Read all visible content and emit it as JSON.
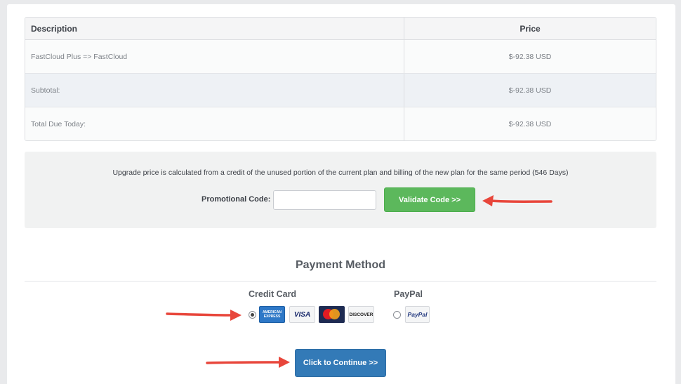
{
  "summary_table": {
    "columns": [
      "Description",
      "Price"
    ],
    "rows": [
      {
        "description": "FastCloud Plus => FastCloud",
        "price": "$-92.38 USD"
      },
      {
        "description": "Subtotal:",
        "price": "$-92.38 USD"
      },
      {
        "description": "Total Due Today:",
        "price": "$-92.38 USD"
      }
    ]
  },
  "promo": {
    "note": "Upgrade price is calculated from a credit of the unused portion of the current plan and billing of the new plan for the same period (546 Days)",
    "label": "Promotional Code:",
    "value": "",
    "placeholder": "",
    "validate_label": "Validate Code >>"
  },
  "payment": {
    "title": "Payment Method",
    "credit_card_label": "Credit Card",
    "paypal_label": "PayPal",
    "selected": "credit_card",
    "cards": [
      "AMERICAN EXPRESS",
      "VISA",
      "mastercard",
      "DISCOVER"
    ],
    "paypal_logo": "PayPal",
    "continue_label": "Click to Continue >>"
  },
  "colors": {
    "accent_green": "#5cb85c",
    "accent_blue": "#337ab7",
    "annotation_arrow": "#e8463b"
  },
  "icons": [
    "amex-card-icon",
    "visa-card-icon",
    "mastercard-icon",
    "discover-card-icon",
    "paypal-icon",
    "annotation-arrow-icon"
  ]
}
